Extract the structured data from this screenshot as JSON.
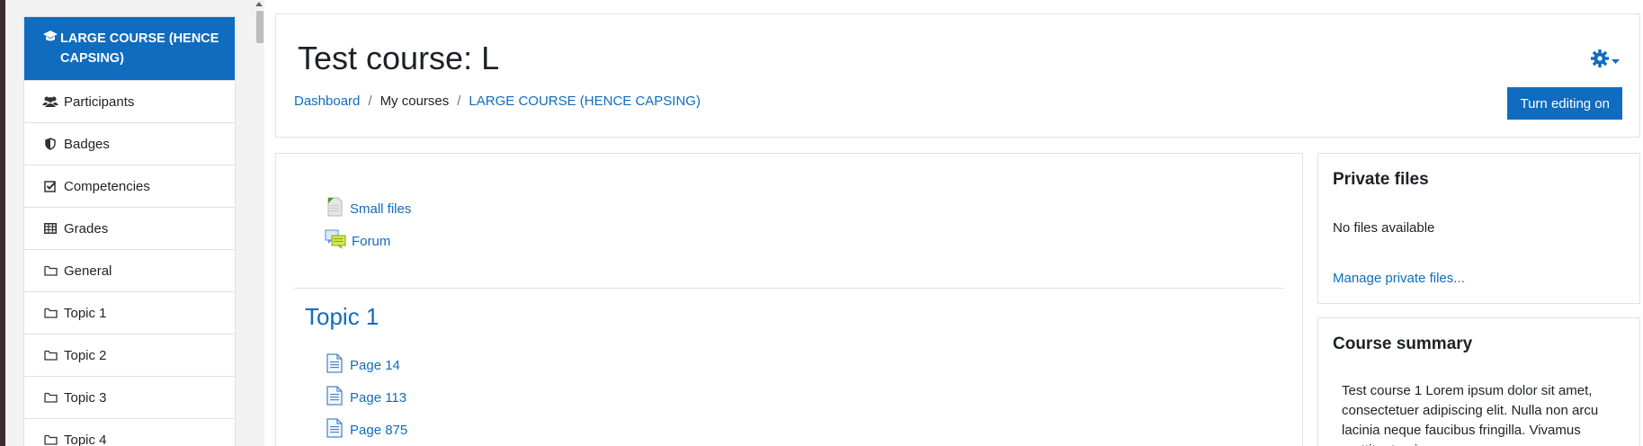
{
  "drawer": {
    "course_label": "LARGE COURSE (HENCE CAPSING)",
    "items": [
      {
        "label": "Participants",
        "icon": "users-icon"
      },
      {
        "label": "Badges",
        "icon": "shield-icon"
      },
      {
        "label": "Competencies",
        "icon": "checkbox-icon"
      },
      {
        "label": "Grades",
        "icon": "table-icon"
      },
      {
        "label": "General",
        "icon": "folder-icon"
      },
      {
        "label": "Topic 1",
        "icon": "folder-icon"
      },
      {
        "label": "Topic 2",
        "icon": "folder-icon"
      },
      {
        "label": "Topic 3",
        "icon": "folder-icon"
      },
      {
        "label": "Topic 4",
        "icon": "folder-icon"
      }
    ]
  },
  "header": {
    "title": "Test course: L",
    "breadcrumb": [
      "Dashboard",
      "My courses",
      "LARGE COURSE (HENCE CAPSING)"
    ],
    "edit_button": "Turn editing on"
  },
  "main": {
    "general_activities": [
      {
        "label": "Small files",
        "icon": "file-icon"
      },
      {
        "label": "Forum",
        "icon": "forum-icon"
      }
    ],
    "section_title": "Topic 1",
    "topic_activities": [
      {
        "label": "Page 14",
        "icon": "page-icon"
      },
      {
        "label": "Page 113",
        "icon": "page-icon"
      },
      {
        "label": "Page 875",
        "icon": "page-icon"
      }
    ]
  },
  "private_files": {
    "title": "Private files",
    "empty_text": "No files available",
    "manage_link": "Manage private files..."
  },
  "course_summary": {
    "title": "Course summary",
    "text": "Test course 1 Lorem ipsum dolor sit amet, consectetuer adipiscing elit. Nulla non arcu lacinia neque faucibus fringilla. Vivamus porttitor turpis ac"
  },
  "colors": {
    "accent": "#0f6cbf",
    "border": "#dee2e6",
    "drawer_bg": "#f2f2f2"
  }
}
